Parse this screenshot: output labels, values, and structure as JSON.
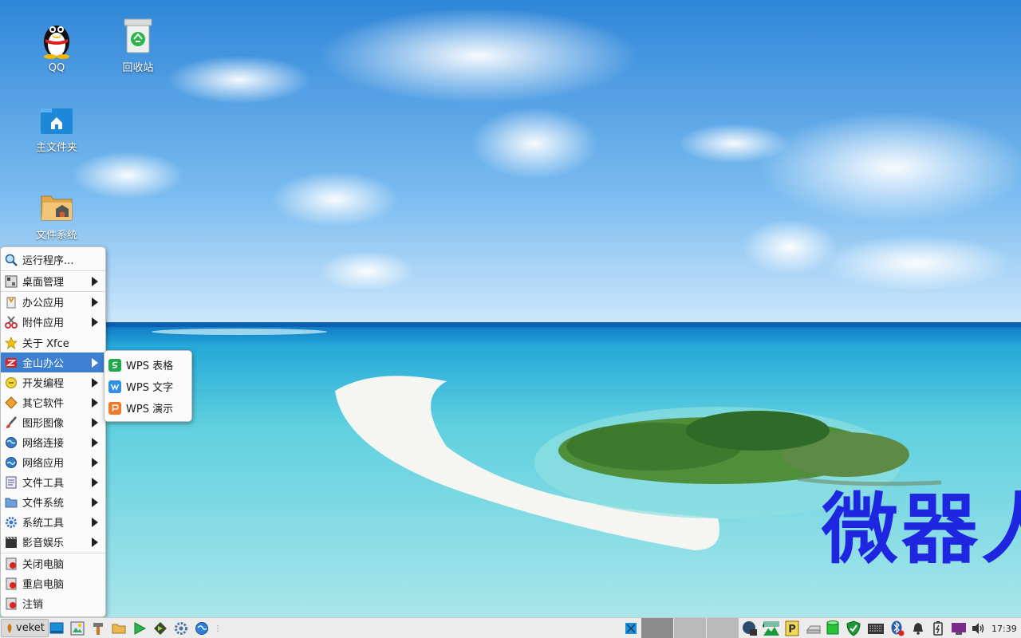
{
  "desktop": {
    "icons": [
      {
        "label": "QQ"
      },
      {
        "label": "回收站"
      },
      {
        "label": "主文件夹"
      },
      {
        "label": "文件系统"
      }
    ],
    "watermark": "微器人"
  },
  "menu": {
    "items": [
      {
        "label": "运行程序...",
        "submenu": false
      },
      {
        "label": "桌面管理",
        "submenu": true
      },
      {
        "label": "办公应用",
        "submenu": true
      },
      {
        "label": "附件应用",
        "submenu": true
      },
      {
        "label": "关于 Xfce",
        "submenu": false
      },
      {
        "label": "金山办公",
        "submenu": true,
        "active": true
      },
      {
        "label": "开发编程",
        "submenu": true
      },
      {
        "label": "其它软件",
        "submenu": true
      },
      {
        "label": "图形图像",
        "submenu": true
      },
      {
        "label": "网络连接",
        "submenu": true
      },
      {
        "label": "网络应用",
        "submenu": true
      },
      {
        "label": "文件工具",
        "submenu": true
      },
      {
        "label": "文件系统",
        "submenu": true
      },
      {
        "label": "系统工具",
        "submenu": true
      },
      {
        "label": "影音娱乐",
        "submenu": true
      },
      {
        "label": "关闭电脑",
        "submenu": false
      },
      {
        "label": "重启电脑",
        "submenu": false
      },
      {
        "label": "注销",
        "submenu": false
      }
    ],
    "submenu_items": [
      {
        "label": "WPS 表格",
        "color": "#21a84a"
      },
      {
        "label": "WPS 文字",
        "color": "#2f8ee6"
      },
      {
        "label": "WPS 演示",
        "color": "#f07a2b"
      }
    ]
  },
  "taskbar": {
    "start_label": "veket",
    "clock": "17:39"
  },
  "colors": {
    "menu_highlight": "#3d7fd1",
    "watermark": "#1f26e0"
  }
}
